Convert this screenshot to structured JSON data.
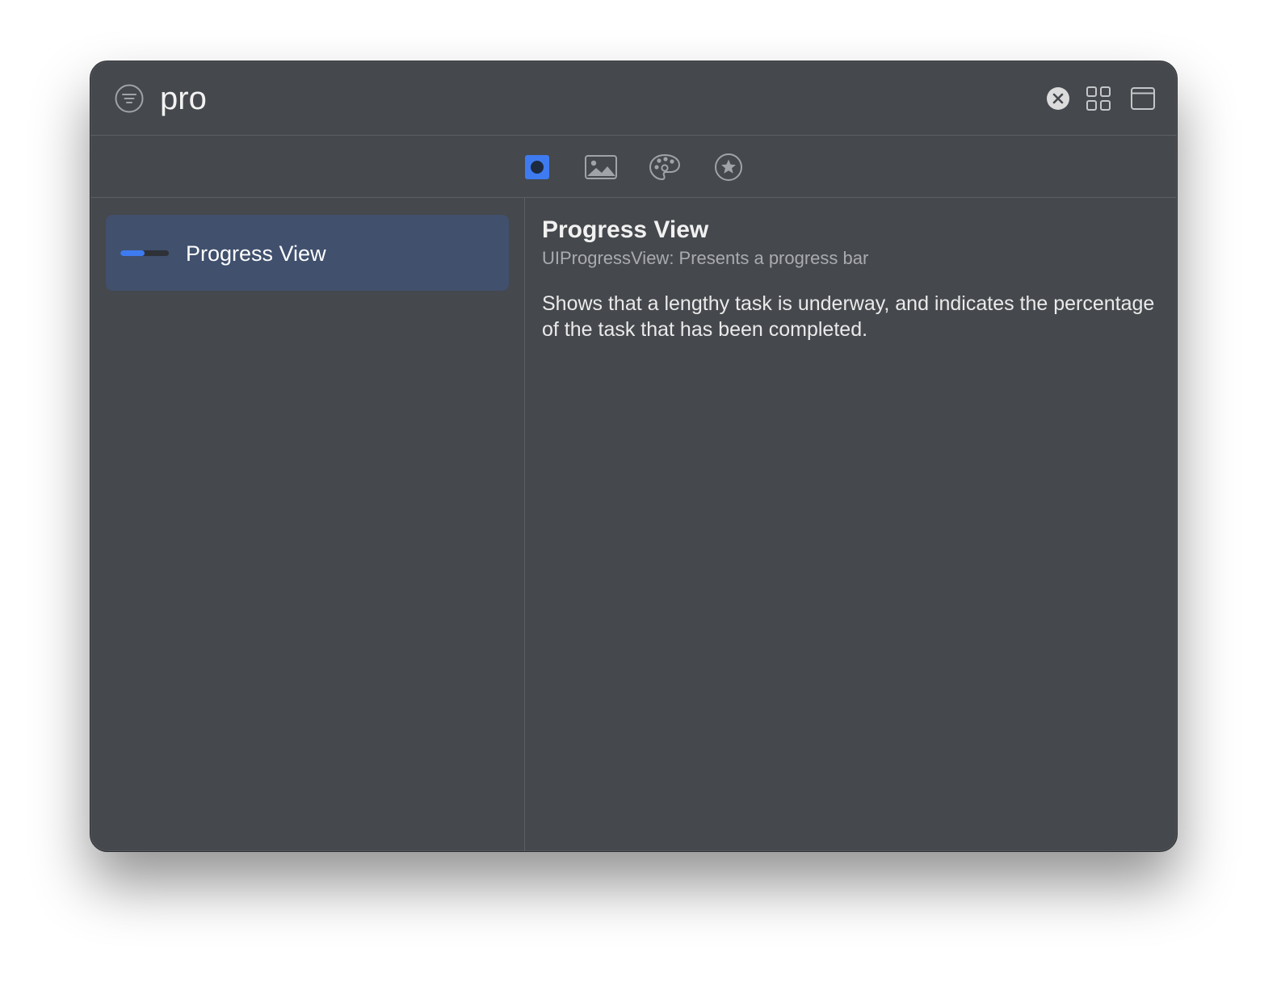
{
  "search": {
    "value": "pro",
    "filter_icon": "filter-circle-icon",
    "clear_icon": "clear-circle-icon",
    "grid_icon": "grid-view-icon",
    "window_icon": "window-icon"
  },
  "tabs": [
    {
      "icon": "components-icon",
      "selected": true
    },
    {
      "icon": "image-icon",
      "selected": false
    },
    {
      "icon": "palette-icon",
      "selected": false
    },
    {
      "icon": "favorites-star-icon",
      "selected": false
    }
  ],
  "results": [
    {
      "label": "Progress View",
      "icon": "progress-bar-icon",
      "progress": 0.5,
      "selected": true
    }
  ],
  "detail": {
    "title": "Progress View",
    "subtitle": "UIProgressView: Presents a progress bar",
    "description": "Shows that a lengthy task is underway, and indicates the percentage of the task that has been completed."
  },
  "colors": {
    "window_bg": "#45484c",
    "selection_bg": "#40506d",
    "accent": "#3e7bf0",
    "icon_gray": "#a0a3a8"
  }
}
